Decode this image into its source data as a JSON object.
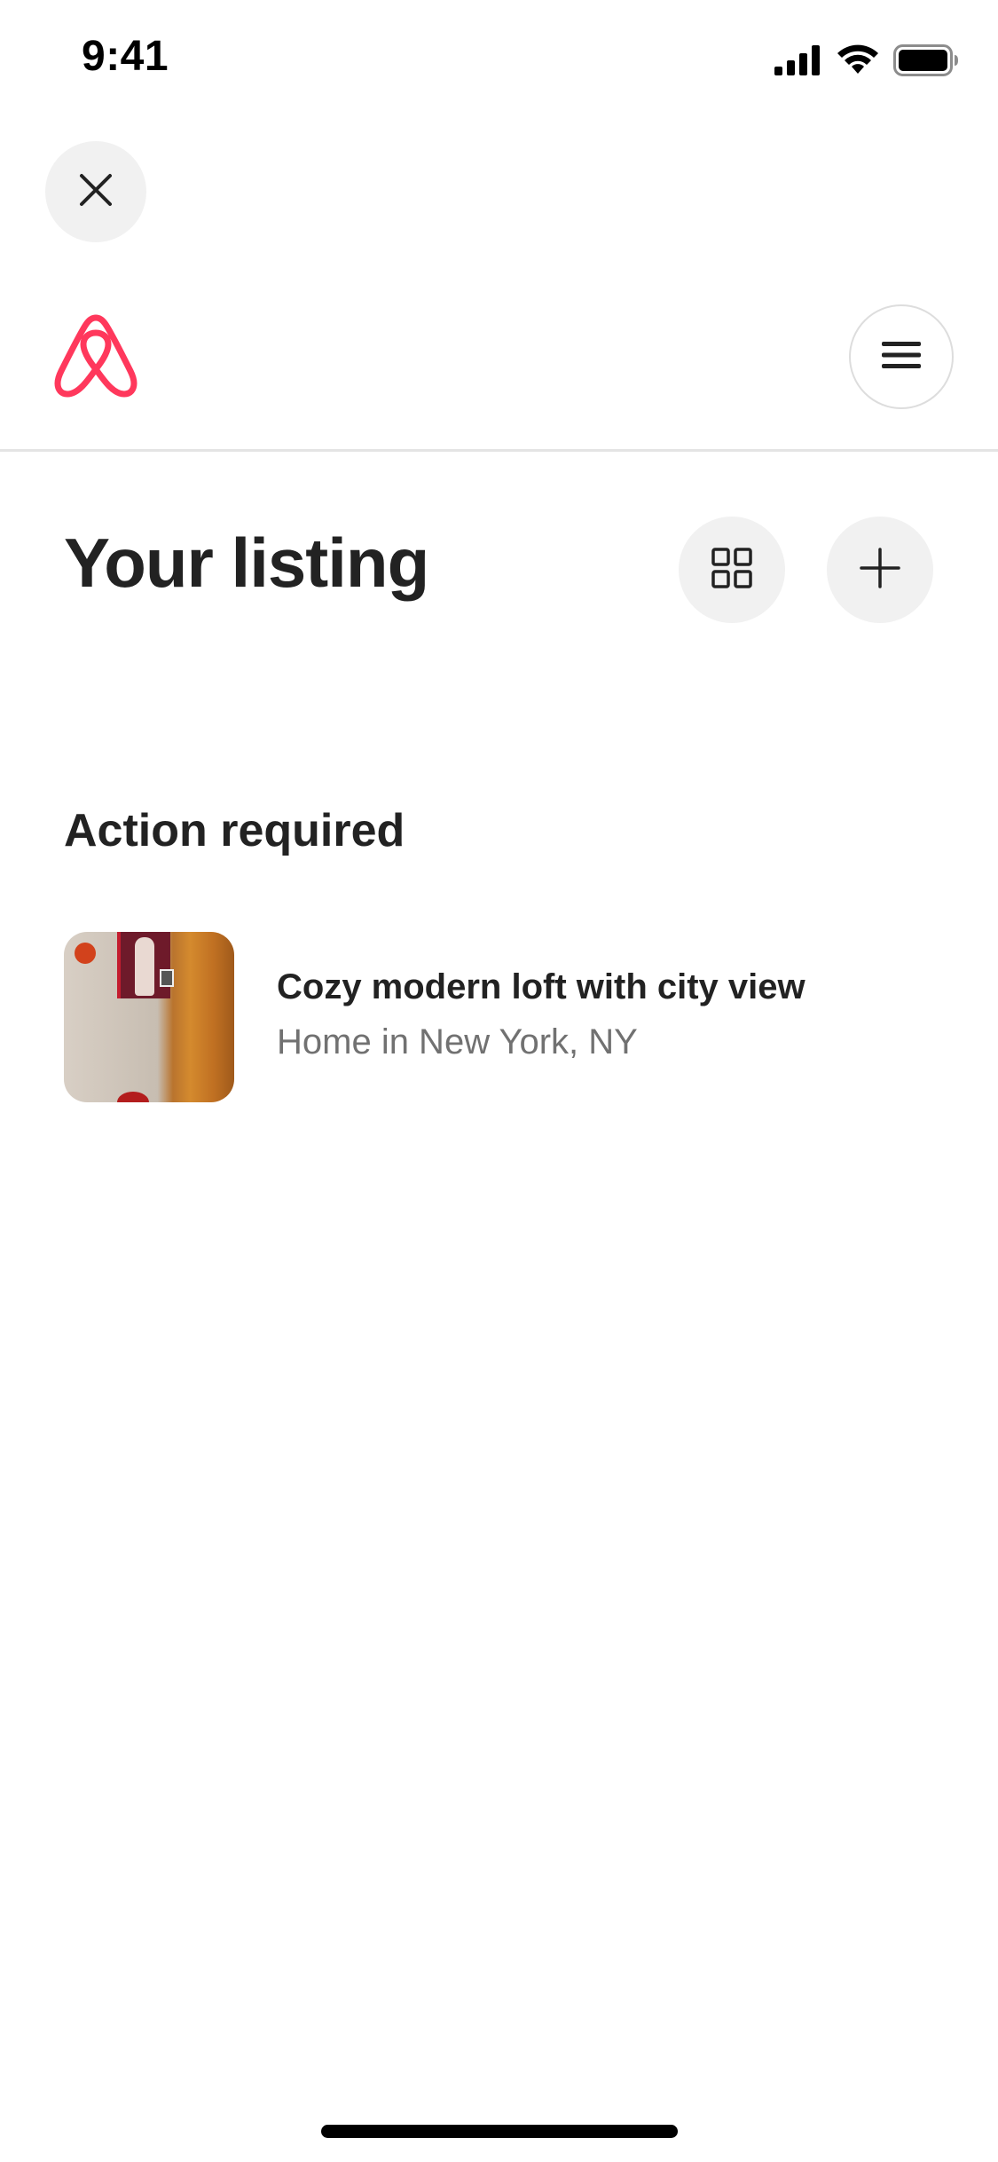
{
  "status_bar": {
    "time": "9:41",
    "icons": [
      "cellular-signal-icon",
      "wifi-icon",
      "battery-icon"
    ]
  },
  "header": {
    "close_icon": "close-icon",
    "logo_icon": "airbnb-logo-icon",
    "menu_icon": "hamburger-menu-icon"
  },
  "page": {
    "title": "Your listing",
    "grid_icon": "grid-view-icon",
    "add_icon": "plus-icon"
  },
  "section": {
    "title": "Action required",
    "listings": [
      {
        "title": "Cozy modern loft with city view",
        "subtitle": "Home in New York, NY"
      }
    ]
  },
  "colors": {
    "brand": "#FF385C",
    "text_primary": "#222222",
    "text_secondary": "#717171",
    "button_bg": "#F1F1F1",
    "divider": "#E4E4E4",
    "status_dot": "#D2421C"
  }
}
